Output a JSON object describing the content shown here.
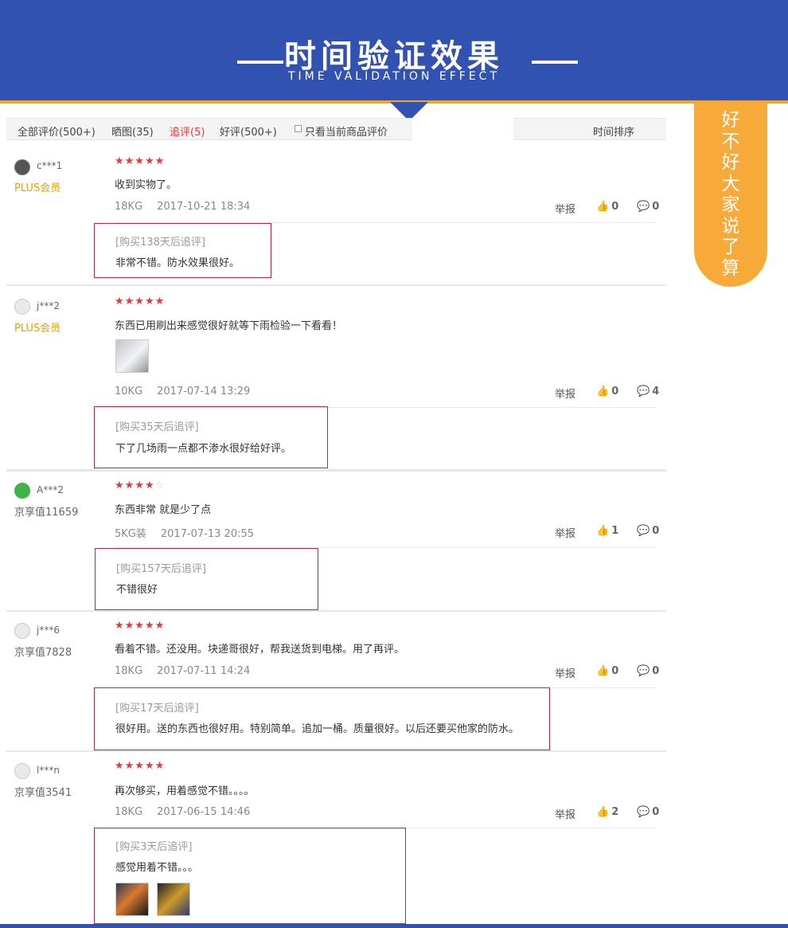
{
  "header": {
    "title": "时间验证效果",
    "subtitle": "TIME VALIDATION EFFECT"
  },
  "side_tag": {
    "chars": [
      "好",
      "不",
      "好",
      "大",
      "家",
      "说",
      "了",
      "算"
    ]
  },
  "tabs": [
    {
      "label": "全部评价(500+)"
    },
    {
      "label": "晒图(35)"
    },
    {
      "label": "追评(5)",
      "active": true
    },
    {
      "label": "好评(500+)"
    }
  ],
  "filter_label": "只看当前商品评价",
  "sort_label": "时间排序",
  "report_label": "举报",
  "colors": {
    "header_bg": "#3152b0",
    "accent_orange": "#f7a93a",
    "star_red": "#e4393c",
    "follow_border": "#a52a5a"
  },
  "reviews": [
    {
      "user": "c***1",
      "level": "PLUS会员",
      "stars": "★★★★★",
      "content": "收到实物了。",
      "spec": "18KG",
      "date": "2017-10-21 18:34",
      "likes": "0",
      "replies": "0",
      "follow_title": "[购买138天后追评]",
      "follow_text": "非常不错。防水效果很好。"
    },
    {
      "user": "j***2",
      "level": "PLUS会员",
      "stars": "★★★★★",
      "content": "东西已用刷出来感觉很好就等下雨检验一下看看！",
      "spec": "10KG",
      "date": "2017-07-14 13:29",
      "likes": "0",
      "replies": "4",
      "follow_title": "[购买35天后追评]",
      "follow_text": "下了几场雨一点都不渗水很好给好评。"
    },
    {
      "user": "A***2",
      "level": "京享值11659",
      "stars": "★★★★",
      "stars_empty": "☆",
      "content": "东西非常 就是少了点",
      "spec": "5KG装",
      "date": "2017-07-13 20:55",
      "likes": "1",
      "replies": "0",
      "follow_title": "[购买157天后追评]",
      "follow_text": "不错很好"
    },
    {
      "user": "j***6",
      "level": "京享值7828",
      "stars": "★★★★★",
      "content": "看着不错。还没用。块递哥很好，帮我送货到电梯。用了再评。",
      "spec": "18KG",
      "date": "2017-07-11 14:24",
      "likes": "0",
      "replies": "0",
      "follow_title": "[购买17天后追评]",
      "follow_text": "很好用。送的东西也很好用。特别简单。追加一桶。质量很好。以后还要买他家的防水。"
    },
    {
      "user": "l***n",
      "level": "京享值3541",
      "stars": "★★★★★",
      "content": "再次够买，用着感觉不错。。。。",
      "spec": "18KG",
      "date": "2017-06-15 14:46",
      "likes": "2",
      "replies": "0",
      "follow_title": "[购买3天后追评]",
      "follow_text": "感觉用着不错。。。"
    }
  ]
}
